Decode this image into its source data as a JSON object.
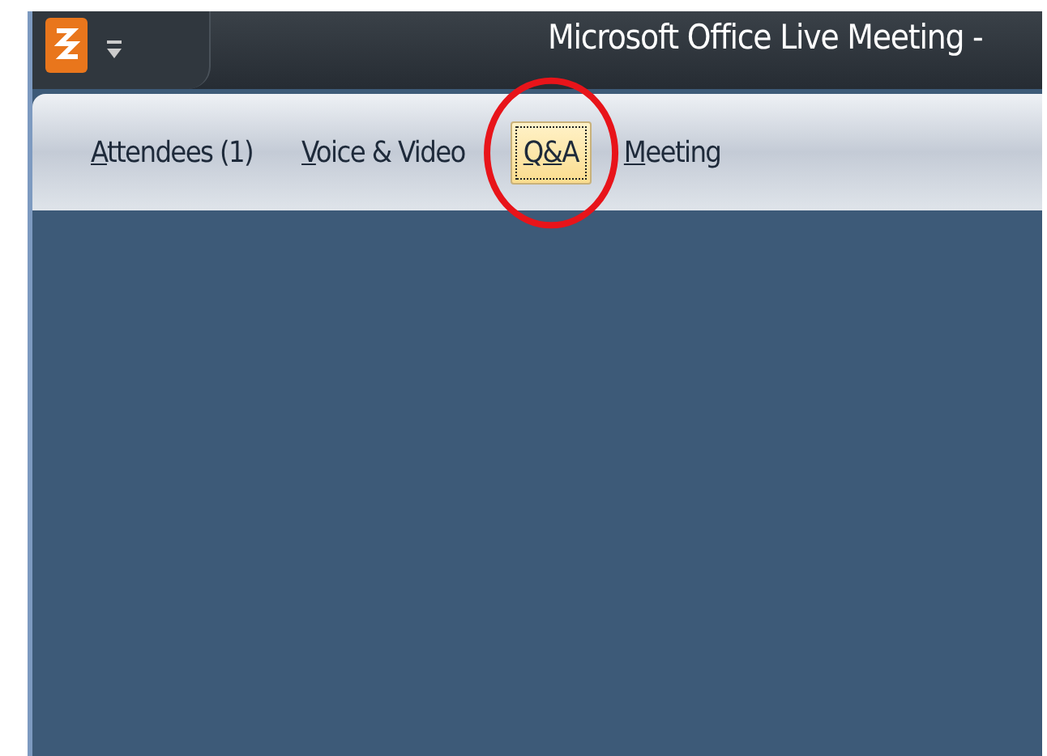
{
  "window": {
    "title": "Microsoft Office Live Meeting -"
  },
  "menu": [
    {
      "label": "Attendees (1)",
      "selected": false,
      "circled": false
    },
    {
      "label": "Voice & Video",
      "selected": false,
      "circled": false
    },
    {
      "label": "Q&A",
      "selected": true,
      "circled": true
    },
    {
      "label": "Meeting",
      "selected": false,
      "circled": false
    }
  ]
}
